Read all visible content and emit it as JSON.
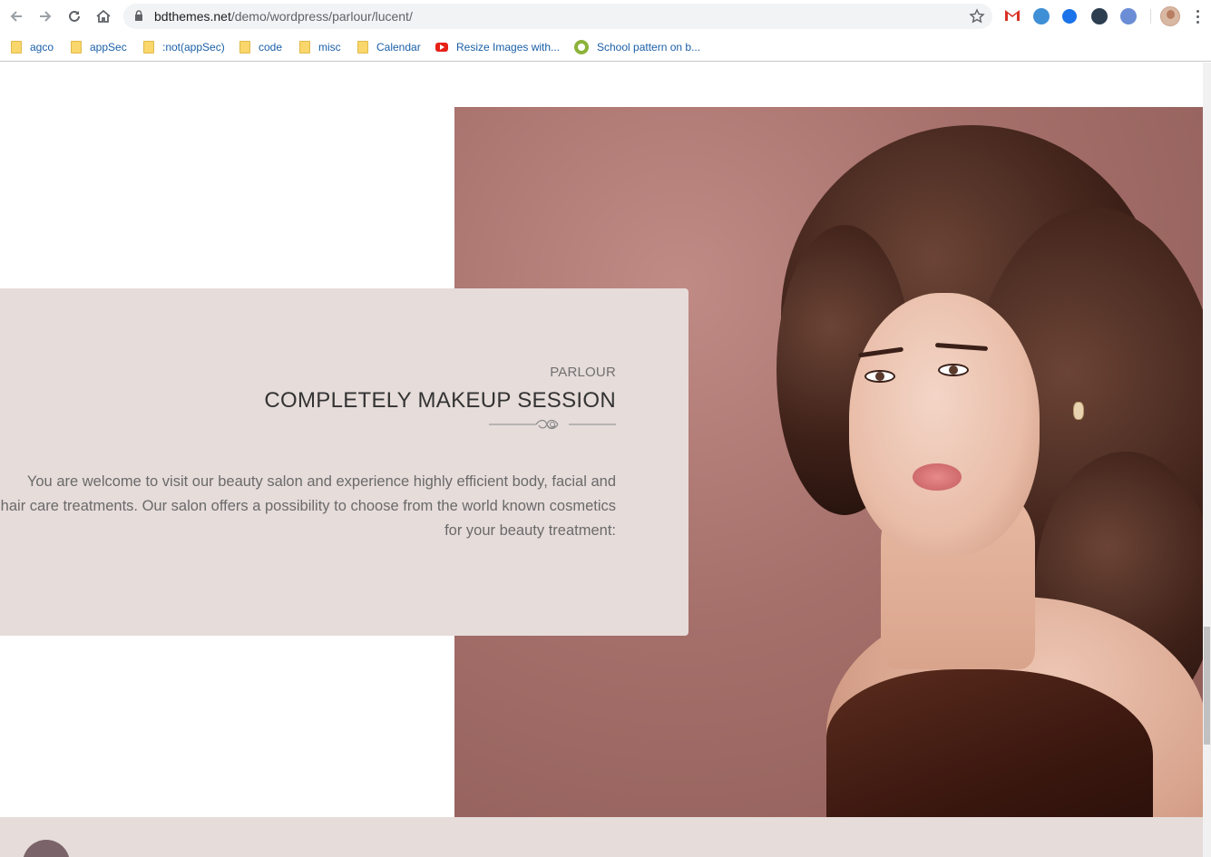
{
  "browser": {
    "url_host": "bdthemes.net",
    "url_path": "/demo/wordpress/parlour/lucent/",
    "bookmarks": [
      {
        "label": "agco",
        "icon": "folder-icon"
      },
      {
        "label": "appSec",
        "icon": "folder-icon"
      },
      {
        "label": ":not(appSec)",
        "icon": "folder-icon"
      },
      {
        "label": "code",
        "icon": "folder-icon"
      },
      {
        "label": "misc",
        "icon": "folder-icon"
      },
      {
        "label": "Calendar",
        "icon": "folder-icon"
      },
      {
        "label": "Resize Images with...",
        "icon": "youtube-icon"
      },
      {
        "label": "School pattern on b...",
        "icon": "site-icon"
      }
    ],
    "extensions": [
      {
        "icon": "gmail-icon",
        "color": "#d93025"
      },
      {
        "icon": "globe-extension-icon",
        "color": "#3f8fd6"
      },
      {
        "icon": "check-extension-icon",
        "color": "#1a73e8"
      },
      {
        "icon": "k-extension-icon",
        "color": "#2c3e50"
      },
      {
        "icon": "shield-extension-icon",
        "color": "#6b8dd6"
      }
    ]
  },
  "page": {
    "section_kicker": "PARLOUR",
    "section_title": "COMPLETELY MAKEUP SESSION",
    "section_text": "You are welcome to visit our beauty salon and experience highly efficient body, facial and hair care treatments. Our salon offers a possibility to choose from the world known cosmetics for your beauty treatment:",
    "card_color": "#e6dcda",
    "photo_subject": "woman-with-curly-hair-photo"
  }
}
